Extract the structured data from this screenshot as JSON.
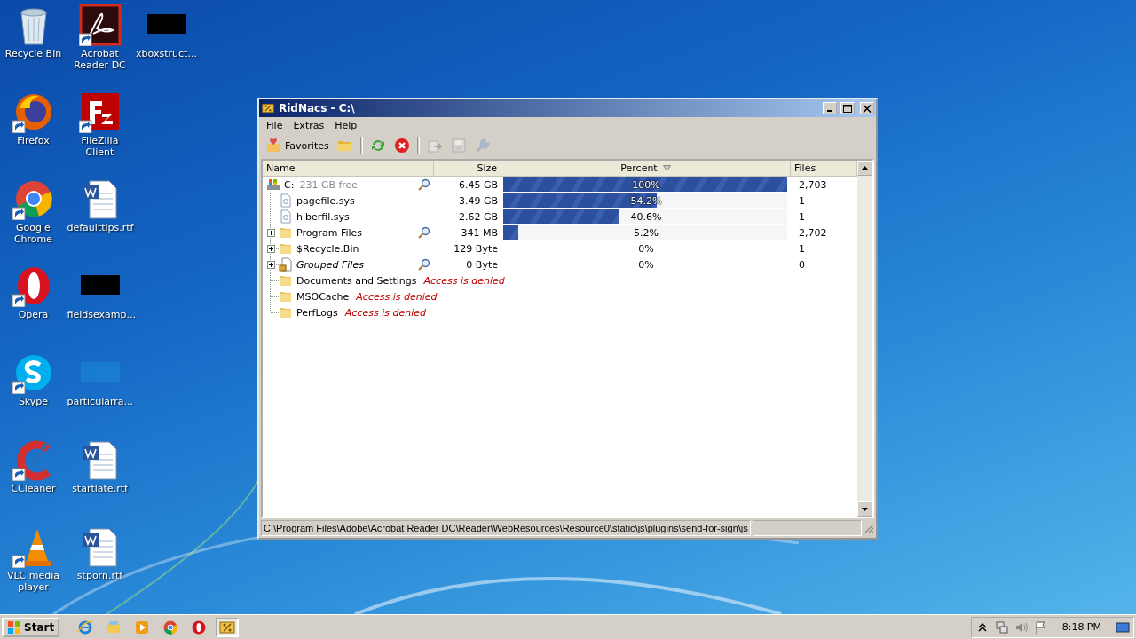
{
  "desktop": {
    "columns": [
      [
        {
          "label": "Recycle Bin",
          "kind": "recycle"
        },
        {
          "label": "Firefox",
          "kind": "firefox",
          "shortcut": true
        },
        {
          "label": "Google Chrome",
          "kind": "chrome",
          "shortcut": true
        },
        {
          "label": "Opera",
          "kind": "opera",
          "shortcut": true
        },
        {
          "label": "Skype",
          "kind": "skype",
          "shortcut": true
        },
        {
          "label": "CCleaner",
          "kind": "ccleaner",
          "shortcut": true
        },
        {
          "label": "VLC media player",
          "kind": "vlc",
          "shortcut": true
        }
      ],
      [
        {
          "label": "Acrobat Reader DC",
          "kind": "acrobat",
          "shortcut": true
        },
        {
          "label": "FileZilla Client",
          "kind": "filezilla",
          "shortcut": true
        },
        {
          "label": "defaulttips.rtf",
          "kind": "word"
        },
        {
          "label": "fieldsexamp...",
          "kind": "dark"
        },
        {
          "label": "particularra...",
          "kind": "blank"
        },
        {
          "label": "startlate.rtf",
          "kind": "word"
        },
        {
          "label": "stporn.rtf",
          "kind": "word"
        }
      ],
      [
        {
          "label": "xboxstruct...",
          "kind": "dark"
        }
      ]
    ]
  },
  "window": {
    "title": "RidNacs - C:\\",
    "menu": [
      "File",
      "Extras",
      "Help"
    ],
    "toolbar": [
      {
        "kind": "favorites",
        "label": "Favorites",
        "disabled": false
      },
      {
        "kind": "folder",
        "disabled": false
      },
      {
        "kind": "separator"
      },
      {
        "kind": "refresh",
        "disabled": false
      },
      {
        "kind": "stop",
        "disabled": false
      },
      {
        "kind": "separator"
      },
      {
        "kind": "export",
        "disabled": true
      },
      {
        "kind": "save",
        "disabled": true
      },
      {
        "kind": "tool",
        "disabled": true
      }
    ],
    "columns": [
      {
        "label": "Name",
        "sorted": false
      },
      {
        "label": "Size",
        "sorted": false
      },
      {
        "label": "Percent",
        "sorted": true
      },
      {
        "label": "Files",
        "sorted": false
      }
    ],
    "tree": [
      {
        "kind": "drive",
        "name": "C:",
        "note": "231 GB free",
        "magnifier": true,
        "size": "6.45 GB",
        "percent": "100%",
        "level": 1,
        "files": "2,703",
        "children": [
          {
            "kind": "file",
            "name": "pagefile.sys",
            "size": "3.49 GB",
            "percent": "54.2%",
            "level": 0.542,
            "files": "1"
          },
          {
            "kind": "file",
            "name": "hiberfil.sys",
            "size": "2.62 GB",
            "percent": "40.6%",
            "level": 0.406,
            "files": "1"
          },
          {
            "kind": "folder",
            "name": "Program Files",
            "expanded": false,
            "magnifier": true,
            "size": "341 MB",
            "percent": "5.2%",
            "level": 0.052,
            "files": "2,702"
          },
          {
            "kind": "folder",
            "name": "$Recycle.Bin",
            "expanded": false,
            "size": "129 Byte",
            "percent": "0%",
            "files": "1"
          },
          {
            "kind": "group",
            "name": "Grouped Files",
            "expanded": false,
            "magnifier": true,
            "size": "0 Byte",
            "percent": "0%",
            "files": "0"
          },
          {
            "kind": "folder",
            "name": "Documents and Settings",
            "error": "Access is denied"
          },
          {
            "kind": "folder",
            "name": "MSOCache",
            "error": "Access is denied"
          },
          {
            "kind": "folder",
            "name": "PerfLogs",
            "error": "Access is denied"
          }
        ]
      }
    ],
    "status_bar": "C:\\Program Files\\Adobe\\Acrobat Reader DC\\Reader\\WebResources\\Resource0\\static\\js\\plugins\\send-for-sign\\js"
  },
  "taskbar": {
    "start": "Start",
    "apps": [
      {
        "kind": "ie",
        "selected": false
      },
      {
        "kind": "explorer",
        "selected": false
      },
      {
        "kind": "media",
        "selected": false
      },
      {
        "kind": "chrome",
        "selected": false
      },
      {
        "kind": "opera",
        "selected": false
      },
      {
        "kind": "ridnacs",
        "selected": true
      }
    ],
    "clock": "8:18 PM"
  }
}
